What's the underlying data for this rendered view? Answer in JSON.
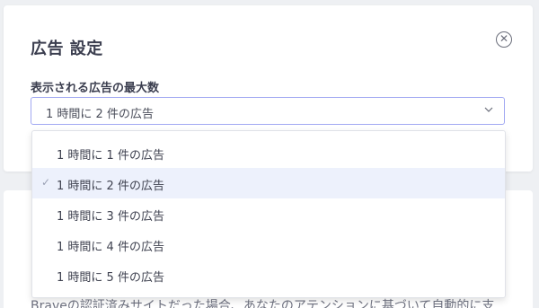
{
  "modal": {
    "title": "広告 設定",
    "close_icon": "close-circle-icon",
    "field_label": "表示される広告の最大数",
    "selected_value": "1 時間に 2 件の広告"
  },
  "dropdown": {
    "options": [
      "1 時間に 1 件の広告",
      "1 時間に 2 件の広告",
      "1 時間に 3 件の広告",
      "1 時間に 4 件の広告",
      "1 時間に 5 件の広告"
    ],
    "selected_index": 1
  },
  "background": {
    "text": "Braveの認証済みサイトだった場合、あなたのアテンションに基づいて自動的に支"
  },
  "colors": {
    "accent_border": "#a1a8f2",
    "selected_bg": "#edf1fc",
    "title": "#3b3e4f"
  }
}
